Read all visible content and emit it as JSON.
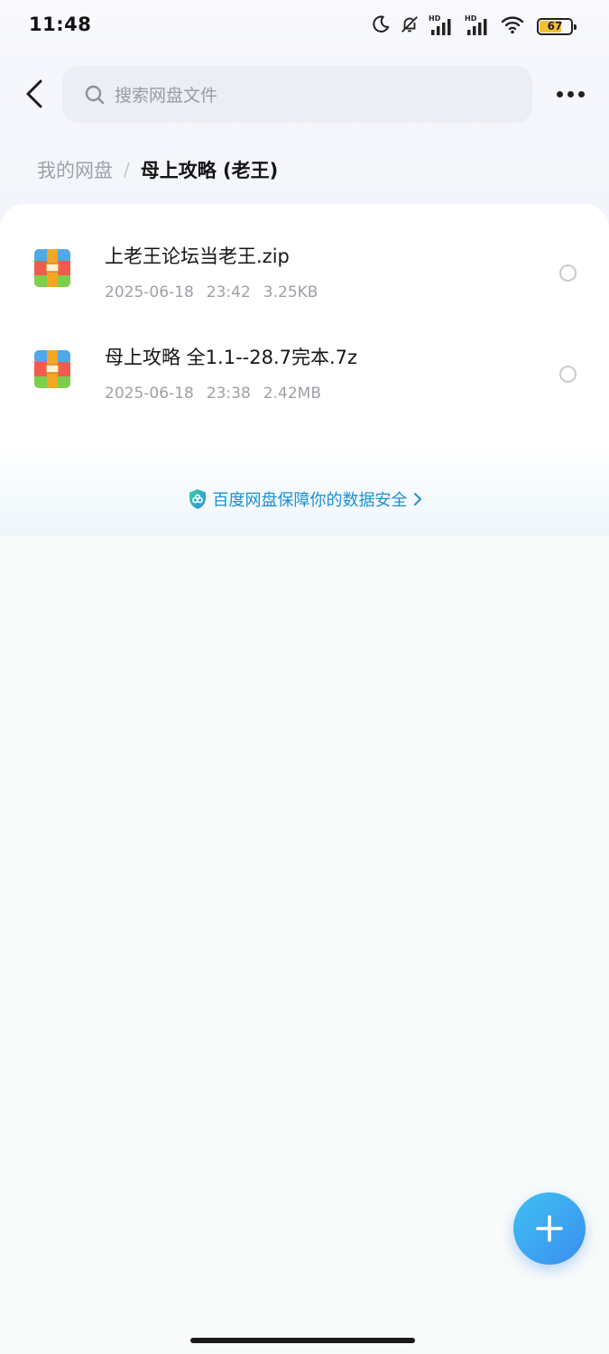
{
  "status_bar": {
    "time": "11:48",
    "signal_label_1": "HD",
    "signal_label_2": "HD",
    "battery_level": "67",
    "icons": [
      "moon-icon",
      "bell-off-icon",
      "signal-icon",
      "signal-icon",
      "wifi-icon",
      "battery-icon"
    ]
  },
  "header": {
    "search_placeholder": "搜索网盘文件",
    "icons": [
      "back-icon",
      "search-icon",
      "more-icon"
    ]
  },
  "breadcrumb": {
    "root": "我的网盘",
    "separator": "/",
    "current": "母上攻略 (老王)"
  },
  "files": [
    {
      "name": "上老王论坛当老王.zip",
      "date": "2025-06-18",
      "time": "23:42",
      "size": "3.25KB",
      "icon": "archive-icon"
    },
    {
      "name": "母上攻略 全1.1--28.7完本.7z",
      "date": "2025-06-18",
      "time": "23:38",
      "size": "2.42MB",
      "icon": "archive-icon"
    }
  ],
  "security_link": {
    "text": "百度网盘保障你的数据安全",
    "icon": "shield-icon"
  },
  "fab": {
    "icon": "plus-icon"
  },
  "colors": {
    "accent": "#1a8fd6",
    "fab_start": "#3fc1f2",
    "fab_end": "#3b8df0",
    "battery": "#f3c233"
  }
}
